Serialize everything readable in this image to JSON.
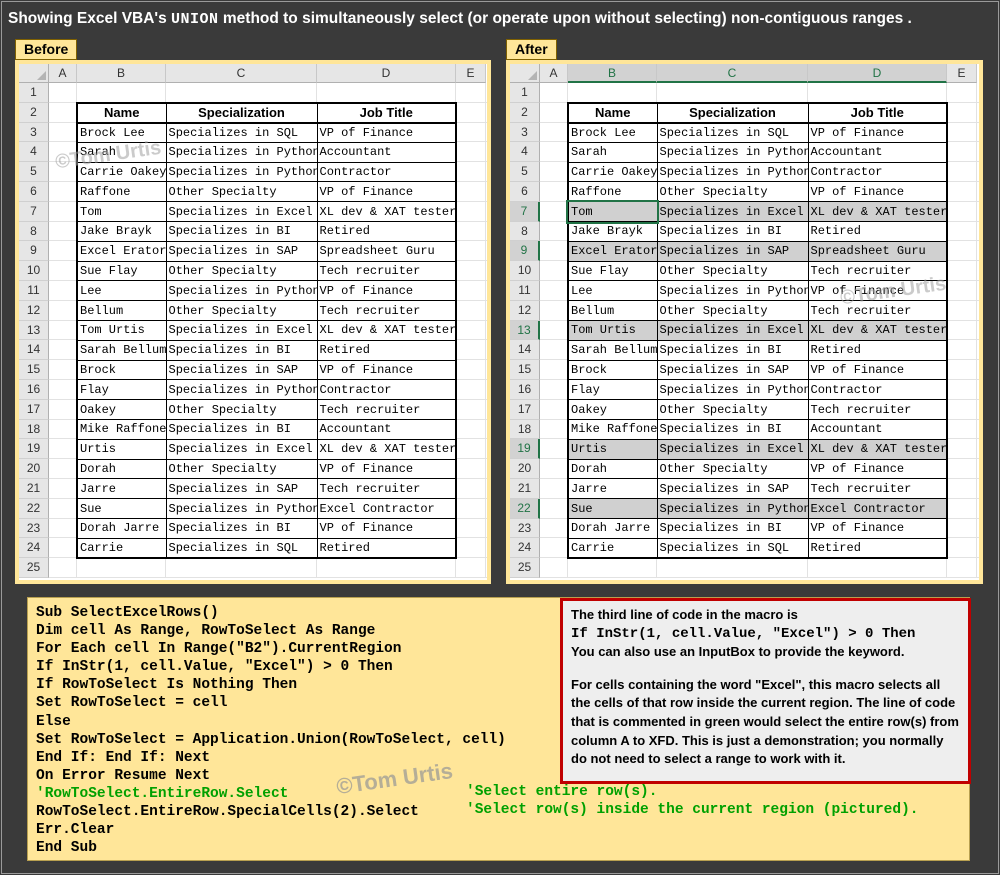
{
  "banner": {
    "prefix": "Showing Excel VBA's",
    "keyword": "UNION",
    "suffix": "method to simultaneously select (or operate upon without selecting) non-contiguous ranges ."
  },
  "before": {
    "label": "Before"
  },
  "after": {
    "label": "After"
  },
  "columns": [
    "A",
    "B",
    "C",
    "D",
    "E"
  ],
  "rows": [
    "1",
    "2",
    "3",
    "4",
    "5",
    "6",
    "7",
    "8",
    "9",
    "10",
    "11",
    "12",
    "13",
    "14",
    "15",
    "16",
    "17",
    "18",
    "19",
    "20",
    "21",
    "22",
    "23",
    "24",
    "25"
  ],
  "table": {
    "headers": [
      "Name",
      "Specialization",
      "Job Title"
    ],
    "records": [
      [
        "Brock Lee",
        "Specializes in SQL",
        "VP of Finance"
      ],
      [
        "Sarah",
        "Specializes in Python",
        "Accountant"
      ],
      [
        "Carrie Oakey",
        "Specializes in Python",
        "Contractor"
      ],
      [
        "Raffone",
        "Other Specialty",
        "VP of Finance"
      ],
      [
        "Tom",
        "Specializes in Excel",
        "XL dev & XAT tester"
      ],
      [
        "Jake Brayk",
        "Specializes in BI",
        "Retired"
      ],
      [
        "Excel Erator",
        "Specializes in SAP",
        "Spreadsheet Guru"
      ],
      [
        "Sue Flay",
        "Other Specialty",
        "Tech recruiter"
      ],
      [
        "Lee",
        "Specializes in Python",
        "VP of Finance"
      ],
      [
        "Bellum",
        "Other Specialty",
        "Tech recruiter"
      ],
      [
        "Tom Urtis",
        "Specializes in Excel",
        "XL dev & XAT tester"
      ],
      [
        "Sarah Bellum",
        "Specializes in BI",
        "Retired"
      ],
      [
        "Brock",
        "Specializes in SAP",
        "VP of Finance"
      ],
      [
        "Flay",
        "Specializes in Python",
        "Contractor"
      ],
      [
        "Oakey",
        "Other Specialty",
        "Tech recruiter"
      ],
      [
        "Mike Raffone",
        "Specializes in BI",
        "Accountant"
      ],
      [
        "Urtis",
        "Specializes in Excel",
        "XL dev & XAT tester"
      ],
      [
        "Dorah",
        "Other Specialty",
        "VP of Finance"
      ],
      [
        "Jarre",
        "Specializes in SAP",
        "Tech recruiter"
      ],
      [
        "Sue",
        "Specializes in Python",
        "Excel Contractor"
      ],
      [
        "Dorah Jarre",
        "Specializes in BI",
        "VP of Finance"
      ],
      [
        "Carrie",
        "Specializes in SQL",
        "Retired"
      ]
    ],
    "highlighted_rows": [
      7,
      9,
      13,
      19,
      22
    ]
  },
  "watermark": "©Tom Urtis",
  "code": {
    "lines": [
      "Sub SelectExcelRows()",
      "Dim cell As Range, RowToSelect As Range",
      "For Each cell In Range(\"B2\").CurrentRegion",
      "If InStr(1, cell.Value, \"Excel\") > 0 Then",
      "If RowToSelect Is Nothing Then",
      "Set RowToSelect = cell",
      "Else",
      "Set RowToSelect = Application.Union(RowToSelect, cell)",
      "End If: End If: Next",
      "On Error Resume Next",
      "'RowToSelect.EntireRow.Select",
      "RowToSelect.EntireRow.SpecialCells(2).Select",
      "Err.Clear",
      "End Sub"
    ],
    "comment_1": "'Select entire row(s).",
    "comment_2": "'Select row(s) inside the current region (pictured)."
  },
  "note": {
    "line1": "The third line of code in the macro is",
    "line2": "If InStr(1, cell.Value, \"Excel\") > 0 Then",
    "line3": "You can also use an InputBox to provide the keyword.",
    "para2": "For cells containing the word \"Excel\", this macro selects all the cells of that row inside the current region. The line of code that is commented in green would select the entire row(s) from column A to XFD. This is just a demonstration; you normally do not need to select a range to work with it."
  },
  "colors": {
    "panel": "#ffe699",
    "selection_gray": "#d0d0d0",
    "excel_green": "#217346",
    "note_border": "#c00000",
    "comment_green": "#00a000"
  }
}
